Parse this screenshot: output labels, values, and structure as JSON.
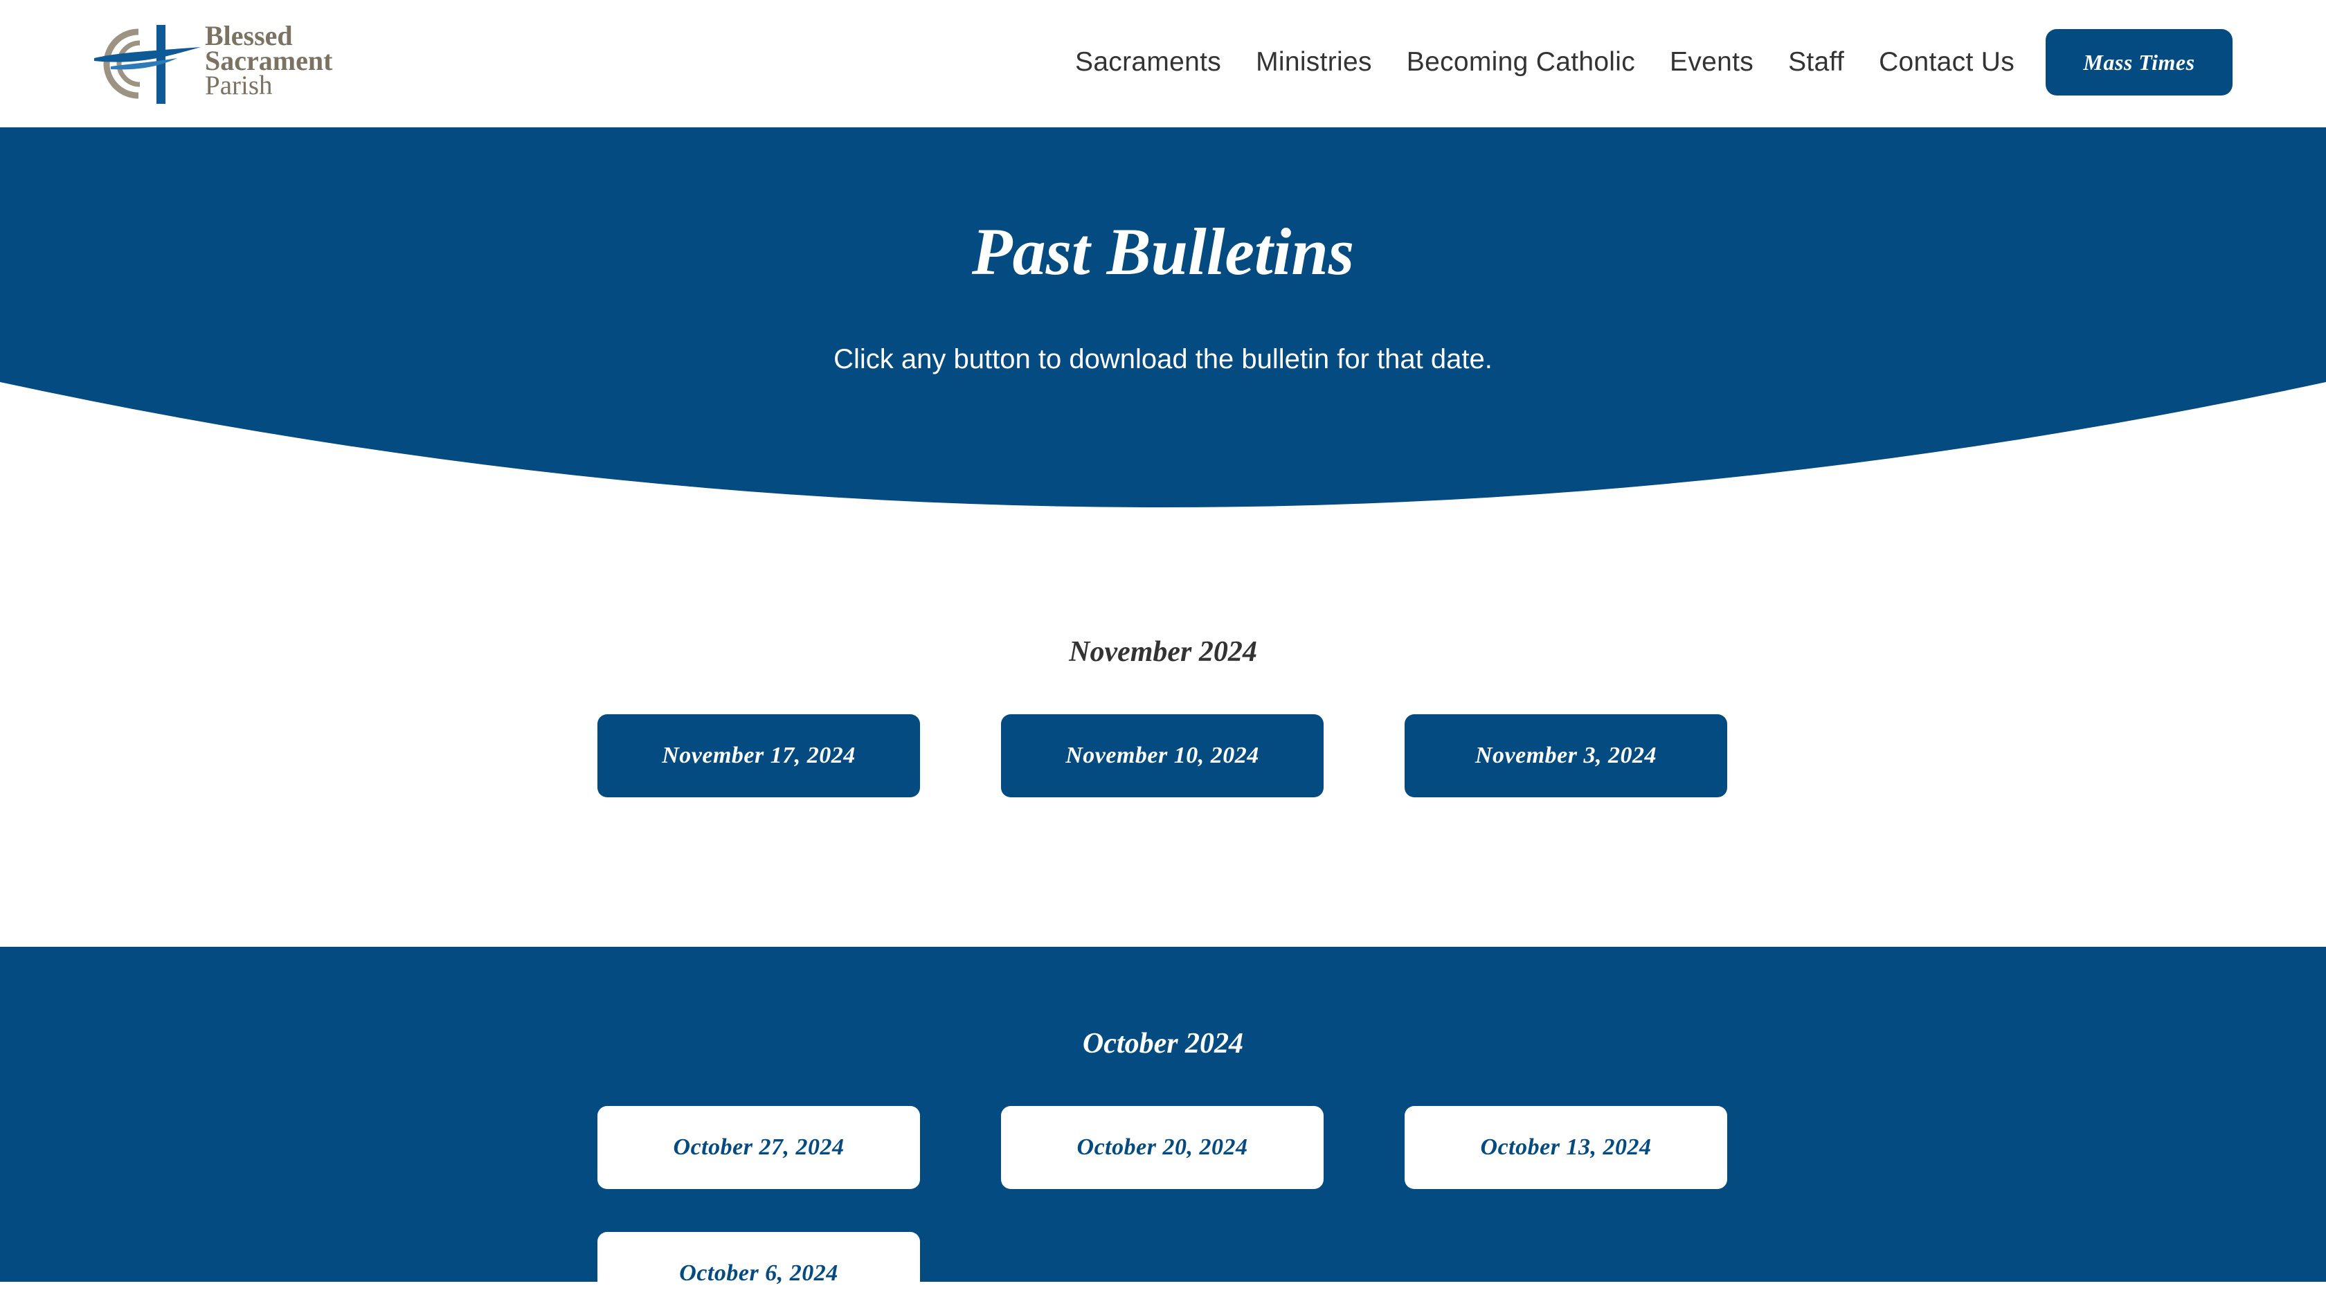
{
  "site": {
    "logo": {
      "line1": "Blessed",
      "line2": "Sacrament",
      "line3": "Parish",
      "icon": "cross-waves-logo-icon"
    },
    "nav": [
      {
        "label": "Sacraments"
      },
      {
        "label": "Ministries"
      },
      {
        "label": "Becoming Catholic"
      },
      {
        "label": "Events"
      },
      {
        "label": "Staff"
      },
      {
        "label": "Contact Us"
      }
    ],
    "cta_label": "Mass Times"
  },
  "hero": {
    "title": "Past Bulletins",
    "subtitle": "Click any button to download the bulletin for that date."
  },
  "months": [
    {
      "heading": "November 2024",
      "bulletins": [
        "November 17, 2024",
        "November 10, 2024",
        "November 3, 2024"
      ]
    },
    {
      "heading": "October 2024",
      "bulletins": [
        "October 27, 2024",
        "October 20, 2024",
        "October 13, 2024",
        "October 6, 2024"
      ]
    }
  ],
  "colors": {
    "brand_blue": "#034b80",
    "logo_brown": "#7c7262",
    "text_dark": "#333333",
    "background": "#ffffff"
  }
}
